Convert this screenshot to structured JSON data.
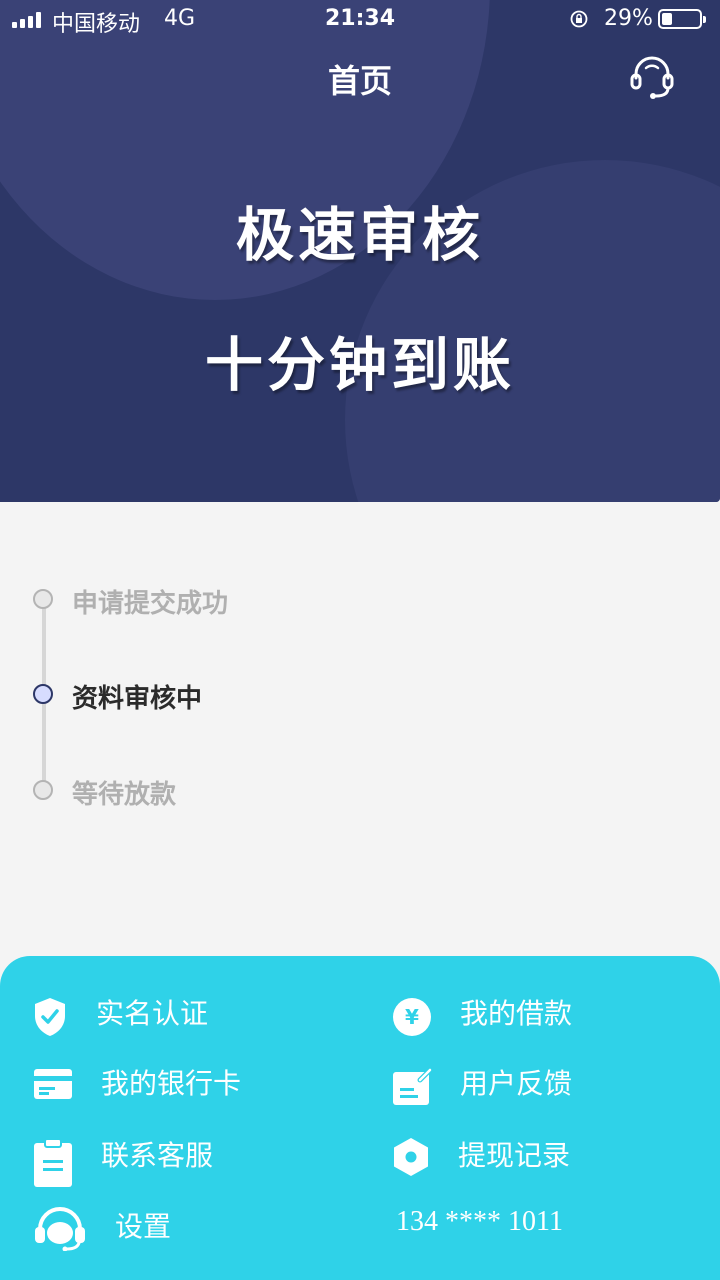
{
  "status_bar": {
    "carrier": "中国移动",
    "network": "4G",
    "time": "21:34",
    "battery_percent": "29%",
    "battery_level": 0.29
  },
  "header": {
    "title": "首页",
    "support_icon": "headset-icon"
  },
  "hero": {
    "line1": "极速审核",
    "line2": "十分钟到账"
  },
  "progress": {
    "steps": [
      {
        "label": "申请提交成功",
        "state": "done"
      },
      {
        "label": "资料审核中",
        "state": "active"
      },
      {
        "label": "等待放款",
        "state": "pending"
      }
    ]
  },
  "menu": {
    "items": [
      {
        "label": "实名认证",
        "icon": "shield-check-icon"
      },
      {
        "label": "我的借款",
        "icon": "yen-coin-icon"
      },
      {
        "label": "我的银行卡",
        "icon": "bank-card-icon"
      },
      {
        "label": "用户反馈",
        "icon": "feedback-edit-icon"
      },
      {
        "label": "联系客服",
        "icon": "clipboard-icon"
      },
      {
        "label": "提现记录",
        "icon": "hexagon-record-icon"
      },
      {
        "label": "设置",
        "icon": "headset-settings-icon"
      }
    ],
    "phone": "134 **** 1011"
  },
  "colors": {
    "header_bg": "#2d3767",
    "panel_bg": "#2fd2e8",
    "page_bg": "#f4f4f4"
  }
}
